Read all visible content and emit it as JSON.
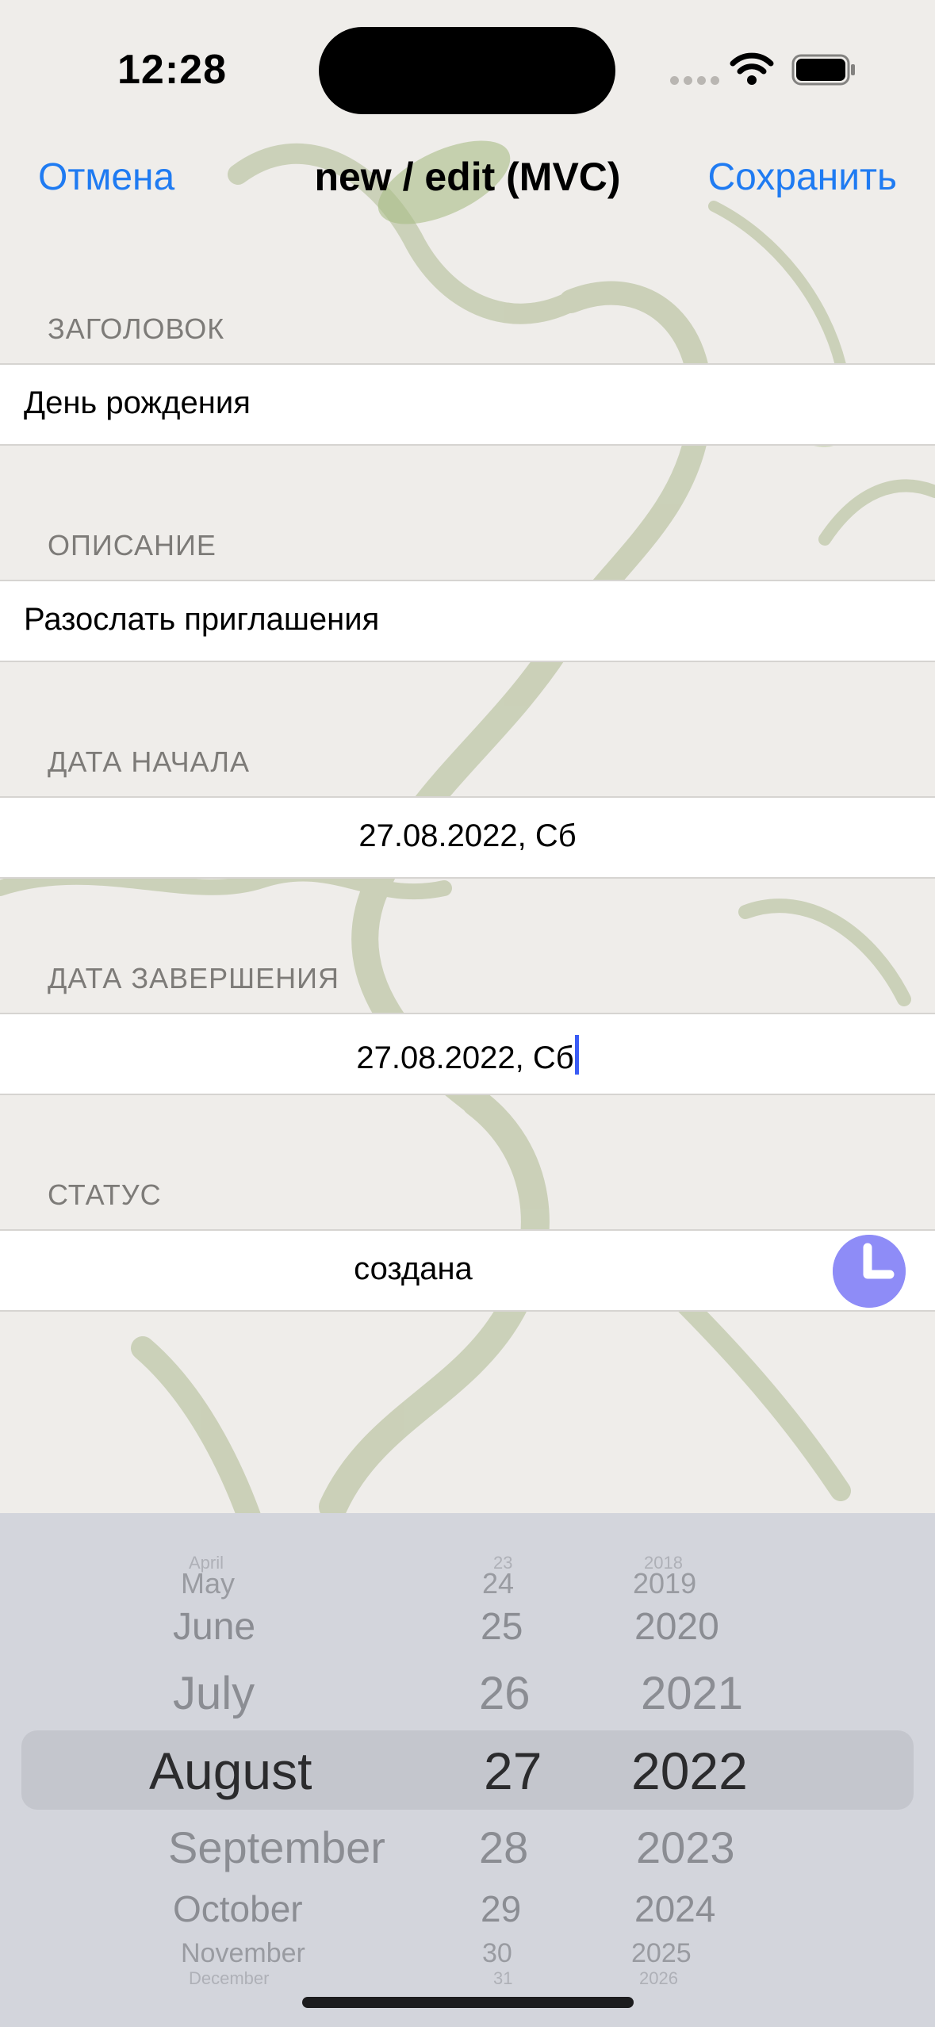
{
  "status_bar": {
    "time": "12:28"
  },
  "nav": {
    "cancel": "Отмена",
    "title": "new / edit (MVC)",
    "save": "Сохранить"
  },
  "form": {
    "title_label": "ЗАГОЛОВОК",
    "title_value": "День рождения",
    "description_label": "ОПИСАНИЕ",
    "description_value": "Разослать приглашения",
    "start_label": "ДАТА НАЧАЛА",
    "start_value": "27.08.2022, Сб",
    "end_label": "ДАТА ЗАВЕРШЕНИЯ",
    "end_value": "27.08.2022, Сб",
    "status_label": "СТАТУС",
    "status_value": "создана"
  },
  "picker": {
    "months": [
      "April",
      "May",
      "June",
      "July",
      "August",
      "September",
      "October",
      "November",
      "December"
    ],
    "days": [
      "23",
      "24",
      "25",
      "26",
      "27",
      "28",
      "29",
      "30",
      "31"
    ],
    "years": [
      "2018",
      "2019",
      "2020",
      "2021",
      "2022",
      "2023",
      "2024",
      "2025",
      "2026"
    ],
    "selected_month": "August",
    "selected_day": "27",
    "selected_year": "2022"
  },
  "icons": {
    "status_button": "clock-icon"
  },
  "colors": {
    "accent": "#1f7bf2",
    "status_button": "#8e8cf7"
  }
}
